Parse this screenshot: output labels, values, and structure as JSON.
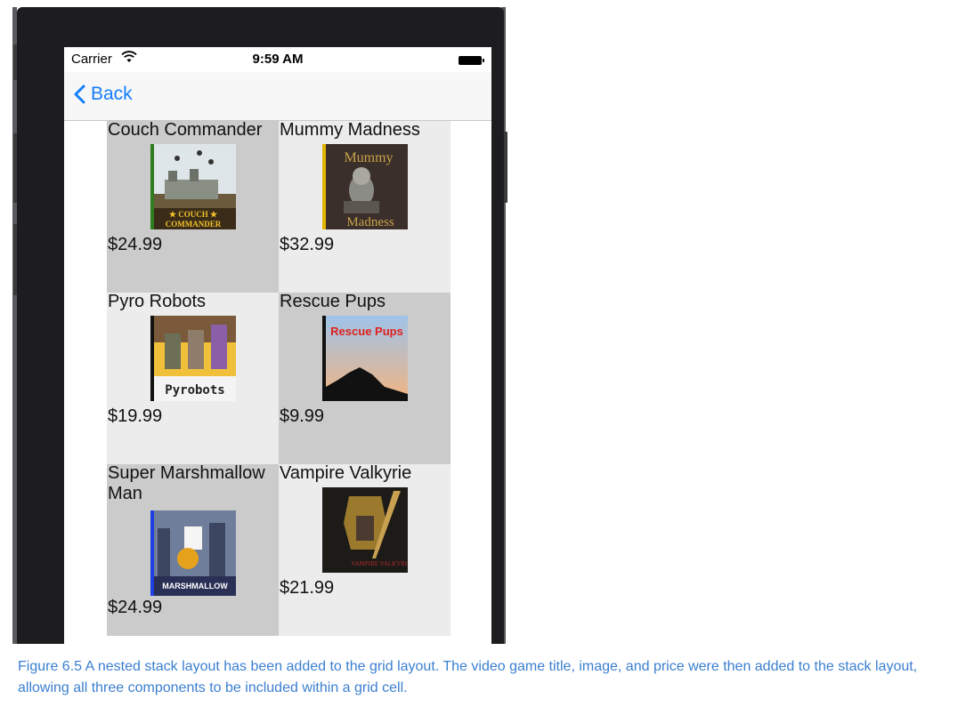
{
  "status": {
    "carrier": "Carrier",
    "time": "9:59 AM"
  },
  "nav": {
    "back_label": "Back"
  },
  "games": [
    {
      "title": "Couch Commander",
      "price": "$24.99",
      "cover_text": "COUCH COMMANDER",
      "cover_top": "Tehona",
      "accent": "#2e7d1e"
    },
    {
      "title": "Mummy Madness",
      "price": "$32.99",
      "cover_text": "Mummy Madness",
      "cover_top": "Tehona",
      "accent": "#e2b400"
    },
    {
      "title": "Pyro Robots",
      "price": "$19.99",
      "cover_text": "Pyrobots",
      "cover_top": "Tehona",
      "accent": "#111111"
    },
    {
      "title": "Rescue Pups",
      "price": "$9.99",
      "cover_text": "Rescue Pups",
      "cover_top": "Tehona",
      "accent": "#111111"
    },
    {
      "title": "Super Marshmallow Man",
      "price": "$24.99",
      "cover_text": "MARSHMALLOW",
      "cover_top": "Tehona",
      "accent": "#1f3fe0"
    },
    {
      "title": "Vampire Valkyrie",
      "price": "$21.99",
      "cover_text": "VAMPIRE VALKYRIE",
      "cover_top": "Tehona",
      "accent": "#111111"
    }
  ],
  "caption": "Figure 6.5 A nested stack layout has been added to the grid layout. The video game title, image, and price were then added to the stack layout, allowing all three components to be included within a grid cell.",
  "colors": {
    "ios_blue": "#147efb",
    "caption_blue": "#3b7fd0",
    "cell_dark": "#cbcbcb",
    "cell_light": "#ececec"
  }
}
